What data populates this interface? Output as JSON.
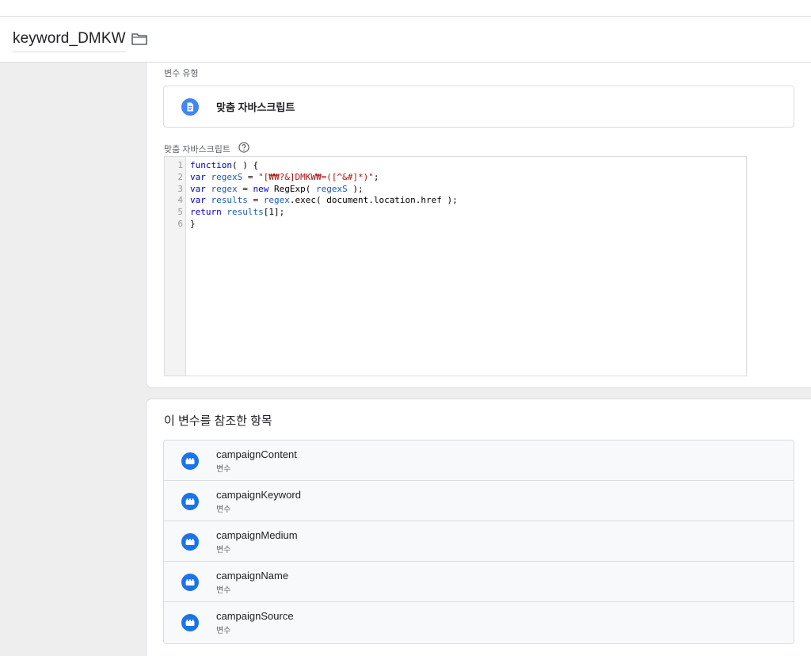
{
  "header": {
    "title": "keyword_DMKW"
  },
  "config": {
    "variable_type_label": "변수 유형",
    "variable_type_name": "맞춤 자바스크립트",
    "script_label": "맞춤 자바스크립트",
    "line_numbers": [
      "1",
      "2",
      "3",
      "4",
      "5",
      "6"
    ],
    "code_lines": [
      "function( ) {",
      "var regexS = \"[₩₩?&]DMKW₩=([^&#]*)\";",
      "var regex = new RegExp( regexS );",
      "var results = regex.exec( document.location.href );",
      "return results[1];",
      "}"
    ]
  },
  "references": {
    "title": "이 변수를 참조한 항목",
    "items": [
      {
        "name": "campaignContent",
        "type": "변수"
      },
      {
        "name": "campaignKeyword",
        "type": "변수"
      },
      {
        "name": "campaignMedium",
        "type": "변수"
      },
      {
        "name": "campaignName",
        "type": "변수"
      },
      {
        "name": "campaignSource",
        "type": "변수"
      }
    ]
  },
  "colors": {
    "accent_blue": "#4285f4",
    "variable_icon_blue": "#1a73e8",
    "keyword_blue": "#0000cc",
    "string_red": "#aa1111"
  },
  "icons": {
    "folder": "folder-icon",
    "custom_js": "document-icon",
    "help": "help-circle-icon",
    "variable": "variable-block-icon"
  }
}
